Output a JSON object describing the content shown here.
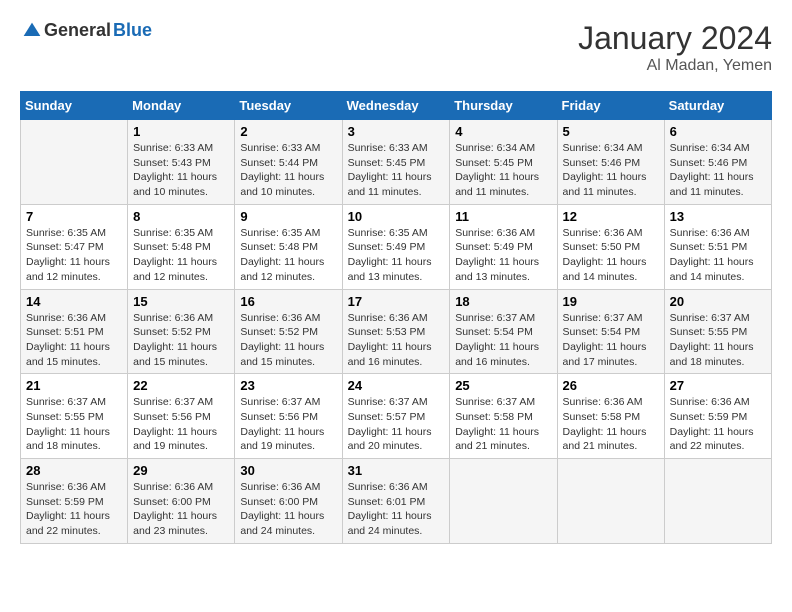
{
  "logo": {
    "general": "General",
    "blue": "Blue"
  },
  "title": {
    "month_year": "January 2024",
    "location": "Al Madan, Yemen"
  },
  "headers": [
    "Sunday",
    "Monday",
    "Tuesday",
    "Wednesday",
    "Thursday",
    "Friday",
    "Saturday"
  ],
  "weeks": [
    [
      {
        "day": "",
        "sunrise": "",
        "sunset": "",
        "daylight": ""
      },
      {
        "day": "1",
        "sunrise": "Sunrise: 6:33 AM",
        "sunset": "Sunset: 5:43 PM",
        "daylight": "Daylight: 11 hours and 10 minutes."
      },
      {
        "day": "2",
        "sunrise": "Sunrise: 6:33 AM",
        "sunset": "Sunset: 5:44 PM",
        "daylight": "Daylight: 11 hours and 10 minutes."
      },
      {
        "day": "3",
        "sunrise": "Sunrise: 6:33 AM",
        "sunset": "Sunset: 5:45 PM",
        "daylight": "Daylight: 11 hours and 11 minutes."
      },
      {
        "day": "4",
        "sunrise": "Sunrise: 6:34 AM",
        "sunset": "Sunset: 5:45 PM",
        "daylight": "Daylight: 11 hours and 11 minutes."
      },
      {
        "day": "5",
        "sunrise": "Sunrise: 6:34 AM",
        "sunset": "Sunset: 5:46 PM",
        "daylight": "Daylight: 11 hours and 11 minutes."
      },
      {
        "day": "6",
        "sunrise": "Sunrise: 6:34 AM",
        "sunset": "Sunset: 5:46 PM",
        "daylight": "Daylight: 11 hours and 11 minutes."
      }
    ],
    [
      {
        "day": "7",
        "sunrise": "Sunrise: 6:35 AM",
        "sunset": "Sunset: 5:47 PM",
        "daylight": "Daylight: 11 hours and 12 minutes."
      },
      {
        "day": "8",
        "sunrise": "Sunrise: 6:35 AM",
        "sunset": "Sunset: 5:48 PM",
        "daylight": "Daylight: 11 hours and 12 minutes."
      },
      {
        "day": "9",
        "sunrise": "Sunrise: 6:35 AM",
        "sunset": "Sunset: 5:48 PM",
        "daylight": "Daylight: 11 hours and 12 minutes."
      },
      {
        "day": "10",
        "sunrise": "Sunrise: 6:35 AM",
        "sunset": "Sunset: 5:49 PM",
        "daylight": "Daylight: 11 hours and 13 minutes."
      },
      {
        "day": "11",
        "sunrise": "Sunrise: 6:36 AM",
        "sunset": "Sunset: 5:49 PM",
        "daylight": "Daylight: 11 hours and 13 minutes."
      },
      {
        "day": "12",
        "sunrise": "Sunrise: 6:36 AM",
        "sunset": "Sunset: 5:50 PM",
        "daylight": "Daylight: 11 hours and 14 minutes."
      },
      {
        "day": "13",
        "sunrise": "Sunrise: 6:36 AM",
        "sunset": "Sunset: 5:51 PM",
        "daylight": "Daylight: 11 hours and 14 minutes."
      }
    ],
    [
      {
        "day": "14",
        "sunrise": "Sunrise: 6:36 AM",
        "sunset": "Sunset: 5:51 PM",
        "daylight": "Daylight: 11 hours and 15 minutes."
      },
      {
        "day": "15",
        "sunrise": "Sunrise: 6:36 AM",
        "sunset": "Sunset: 5:52 PM",
        "daylight": "Daylight: 11 hours and 15 minutes."
      },
      {
        "day": "16",
        "sunrise": "Sunrise: 6:36 AM",
        "sunset": "Sunset: 5:52 PM",
        "daylight": "Daylight: 11 hours and 15 minutes."
      },
      {
        "day": "17",
        "sunrise": "Sunrise: 6:36 AM",
        "sunset": "Sunset: 5:53 PM",
        "daylight": "Daylight: 11 hours and 16 minutes."
      },
      {
        "day": "18",
        "sunrise": "Sunrise: 6:37 AM",
        "sunset": "Sunset: 5:54 PM",
        "daylight": "Daylight: 11 hours and 16 minutes."
      },
      {
        "day": "19",
        "sunrise": "Sunrise: 6:37 AM",
        "sunset": "Sunset: 5:54 PM",
        "daylight": "Daylight: 11 hours and 17 minutes."
      },
      {
        "day": "20",
        "sunrise": "Sunrise: 6:37 AM",
        "sunset": "Sunset: 5:55 PM",
        "daylight": "Daylight: 11 hours and 18 minutes."
      }
    ],
    [
      {
        "day": "21",
        "sunrise": "Sunrise: 6:37 AM",
        "sunset": "Sunset: 5:55 PM",
        "daylight": "Daylight: 11 hours and 18 minutes."
      },
      {
        "day": "22",
        "sunrise": "Sunrise: 6:37 AM",
        "sunset": "Sunset: 5:56 PM",
        "daylight": "Daylight: 11 hours and 19 minutes."
      },
      {
        "day": "23",
        "sunrise": "Sunrise: 6:37 AM",
        "sunset": "Sunset: 5:56 PM",
        "daylight": "Daylight: 11 hours and 19 minutes."
      },
      {
        "day": "24",
        "sunrise": "Sunrise: 6:37 AM",
        "sunset": "Sunset: 5:57 PM",
        "daylight": "Daylight: 11 hours and 20 minutes."
      },
      {
        "day": "25",
        "sunrise": "Sunrise: 6:37 AM",
        "sunset": "Sunset: 5:58 PM",
        "daylight": "Daylight: 11 hours and 21 minutes."
      },
      {
        "day": "26",
        "sunrise": "Sunrise: 6:36 AM",
        "sunset": "Sunset: 5:58 PM",
        "daylight": "Daylight: 11 hours and 21 minutes."
      },
      {
        "day": "27",
        "sunrise": "Sunrise: 6:36 AM",
        "sunset": "Sunset: 5:59 PM",
        "daylight": "Daylight: 11 hours and 22 minutes."
      }
    ],
    [
      {
        "day": "28",
        "sunrise": "Sunrise: 6:36 AM",
        "sunset": "Sunset: 5:59 PM",
        "daylight": "Daylight: 11 hours and 22 minutes."
      },
      {
        "day": "29",
        "sunrise": "Sunrise: 6:36 AM",
        "sunset": "Sunset: 6:00 PM",
        "daylight": "Daylight: 11 hours and 23 minutes."
      },
      {
        "day": "30",
        "sunrise": "Sunrise: 6:36 AM",
        "sunset": "Sunset: 6:00 PM",
        "daylight": "Daylight: 11 hours and 24 minutes."
      },
      {
        "day": "31",
        "sunrise": "Sunrise: 6:36 AM",
        "sunset": "Sunset: 6:01 PM",
        "daylight": "Daylight: 11 hours and 24 minutes."
      },
      {
        "day": "",
        "sunrise": "",
        "sunset": "",
        "daylight": ""
      },
      {
        "day": "",
        "sunrise": "",
        "sunset": "",
        "daylight": ""
      },
      {
        "day": "",
        "sunrise": "",
        "sunset": "",
        "daylight": ""
      }
    ]
  ]
}
